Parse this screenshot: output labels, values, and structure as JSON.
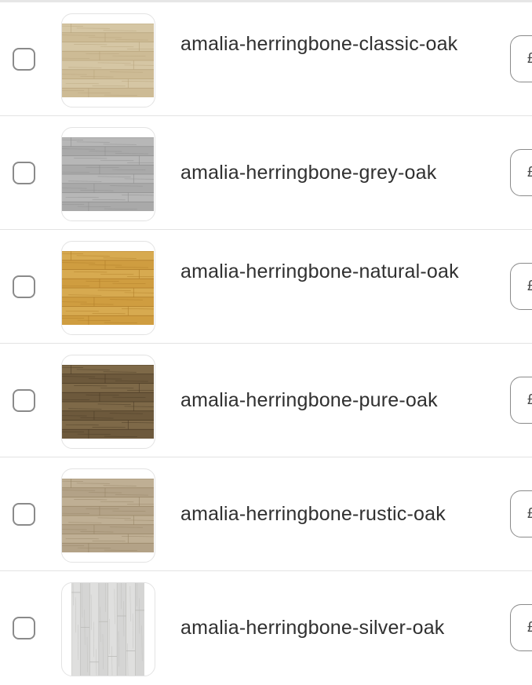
{
  "products": [
    {
      "title": "amalia-herringbone-classic-oak",
      "checked": false,
      "thumbnail": {
        "alt": "classic-oak-swatch",
        "base": "#cdbb96",
        "grain": "#b8a47c",
        "light": "#ddd0b0"
      }
    },
    {
      "title": "amalia-herringbone-grey-oak",
      "checked": false,
      "thumbnail": {
        "alt": "grey-oak-swatch",
        "base": "#a9a9a9",
        "grain": "#8f8f8f",
        "light": "#c3c3c3"
      }
    },
    {
      "title": "amalia-herringbone-natural-oak",
      "checked": false,
      "thumbnail": {
        "alt": "natural-oak-swatch",
        "base": "#cf9d40",
        "grain": "#b07d28",
        "light": "#dfb45c"
      }
    },
    {
      "title": "amalia-herringbone-pure-oak",
      "checked": false,
      "thumbnail": {
        "alt": "pure-oak-swatch",
        "base": "#6e5a3c",
        "grain": "#4b3c26",
        "light": "#8c7652"
      }
    },
    {
      "title": "amalia-herringbone-rustic-oak",
      "checked": false,
      "thumbnail": {
        "alt": "rustic-oak-swatch",
        "base": "#b3a287",
        "grain": "#978566",
        "light": "#c8b99e"
      }
    },
    {
      "title": "amalia-herringbone-silver-oak",
      "checked": false,
      "thumbnail": {
        "alt": "silver-oak-swatch",
        "base": "#d6d6d4",
        "grain": "#b9b9b6",
        "light": "#e8e8e6"
      }
    }
  ],
  "row_action_glyph": "£"
}
